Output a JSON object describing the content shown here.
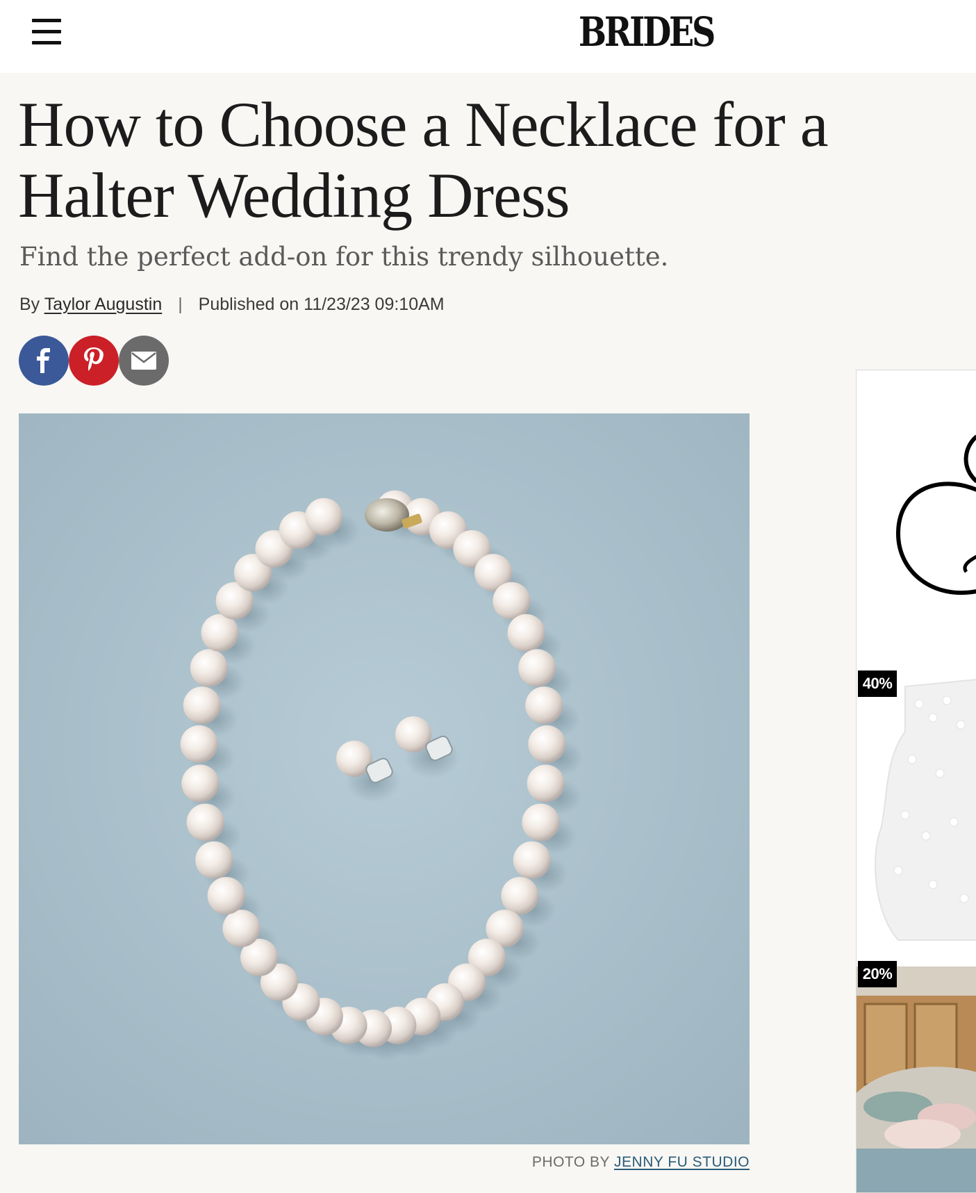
{
  "header": {
    "menu_icon": "hamburger-menu-icon",
    "logo": "BRIDES"
  },
  "article": {
    "title": "How to Choose a Necklace for a Halter Wedding Dress",
    "subtitle": "Find the perfect add-on for this trendy silhouette.",
    "byline_prefix": "By",
    "author": "Taylor Augustin",
    "published": "Published on 11/23/23 09:10AM",
    "share": {
      "facebook_icon": "facebook-icon",
      "pinterest_icon": "pinterest-icon",
      "email_icon": "email-icon"
    },
    "hero_image": {
      "credit_prefix": "PHOTO BY",
      "credit_name": "JENNY FU STUDIO"
    }
  },
  "sidebar_ad": {
    "badges": [
      "40%",
      "20%"
    ]
  },
  "colors": {
    "page_bg": "#f8f7f4",
    "facebook": "#3b5998",
    "pinterest": "#cb2027",
    "email": "#6b6b6b",
    "photo_bg": "#a8bfcb",
    "credit_link": "#2a5b78"
  }
}
